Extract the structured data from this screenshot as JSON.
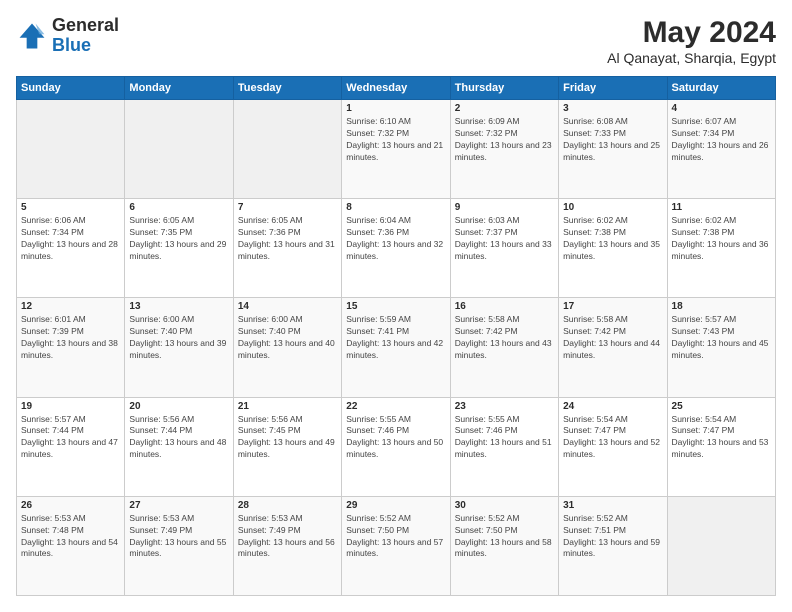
{
  "logo": {
    "line1": "General",
    "line2": "Blue"
  },
  "title": "May 2024",
  "subtitle": "Al Qanayat, Sharqia, Egypt",
  "weekdays": [
    "Sunday",
    "Monday",
    "Tuesday",
    "Wednesday",
    "Thursday",
    "Friday",
    "Saturday"
  ],
  "weeks": [
    [
      {
        "day": "",
        "sunrise": "",
        "sunset": "",
        "daylight": ""
      },
      {
        "day": "",
        "sunrise": "",
        "sunset": "",
        "daylight": ""
      },
      {
        "day": "",
        "sunrise": "",
        "sunset": "",
        "daylight": ""
      },
      {
        "day": "1",
        "sunrise": "Sunrise: 6:10 AM",
        "sunset": "Sunset: 7:32 PM",
        "daylight": "Daylight: 13 hours and 21 minutes."
      },
      {
        "day": "2",
        "sunrise": "Sunrise: 6:09 AM",
        "sunset": "Sunset: 7:32 PM",
        "daylight": "Daylight: 13 hours and 23 minutes."
      },
      {
        "day": "3",
        "sunrise": "Sunrise: 6:08 AM",
        "sunset": "Sunset: 7:33 PM",
        "daylight": "Daylight: 13 hours and 25 minutes."
      },
      {
        "day": "4",
        "sunrise": "Sunrise: 6:07 AM",
        "sunset": "Sunset: 7:34 PM",
        "daylight": "Daylight: 13 hours and 26 minutes."
      }
    ],
    [
      {
        "day": "5",
        "sunrise": "Sunrise: 6:06 AM",
        "sunset": "Sunset: 7:34 PM",
        "daylight": "Daylight: 13 hours and 28 minutes."
      },
      {
        "day": "6",
        "sunrise": "Sunrise: 6:05 AM",
        "sunset": "Sunset: 7:35 PM",
        "daylight": "Daylight: 13 hours and 29 minutes."
      },
      {
        "day": "7",
        "sunrise": "Sunrise: 6:05 AM",
        "sunset": "Sunset: 7:36 PM",
        "daylight": "Daylight: 13 hours and 31 minutes."
      },
      {
        "day": "8",
        "sunrise": "Sunrise: 6:04 AM",
        "sunset": "Sunset: 7:36 PM",
        "daylight": "Daylight: 13 hours and 32 minutes."
      },
      {
        "day": "9",
        "sunrise": "Sunrise: 6:03 AM",
        "sunset": "Sunset: 7:37 PM",
        "daylight": "Daylight: 13 hours and 33 minutes."
      },
      {
        "day": "10",
        "sunrise": "Sunrise: 6:02 AM",
        "sunset": "Sunset: 7:38 PM",
        "daylight": "Daylight: 13 hours and 35 minutes."
      },
      {
        "day": "11",
        "sunrise": "Sunrise: 6:02 AM",
        "sunset": "Sunset: 7:38 PM",
        "daylight": "Daylight: 13 hours and 36 minutes."
      }
    ],
    [
      {
        "day": "12",
        "sunrise": "Sunrise: 6:01 AM",
        "sunset": "Sunset: 7:39 PM",
        "daylight": "Daylight: 13 hours and 38 minutes."
      },
      {
        "day": "13",
        "sunrise": "Sunrise: 6:00 AM",
        "sunset": "Sunset: 7:40 PM",
        "daylight": "Daylight: 13 hours and 39 minutes."
      },
      {
        "day": "14",
        "sunrise": "Sunrise: 6:00 AM",
        "sunset": "Sunset: 7:40 PM",
        "daylight": "Daylight: 13 hours and 40 minutes."
      },
      {
        "day": "15",
        "sunrise": "Sunrise: 5:59 AM",
        "sunset": "Sunset: 7:41 PM",
        "daylight": "Daylight: 13 hours and 42 minutes."
      },
      {
        "day": "16",
        "sunrise": "Sunrise: 5:58 AM",
        "sunset": "Sunset: 7:42 PM",
        "daylight": "Daylight: 13 hours and 43 minutes."
      },
      {
        "day": "17",
        "sunrise": "Sunrise: 5:58 AM",
        "sunset": "Sunset: 7:42 PM",
        "daylight": "Daylight: 13 hours and 44 minutes."
      },
      {
        "day": "18",
        "sunrise": "Sunrise: 5:57 AM",
        "sunset": "Sunset: 7:43 PM",
        "daylight": "Daylight: 13 hours and 45 minutes."
      }
    ],
    [
      {
        "day": "19",
        "sunrise": "Sunrise: 5:57 AM",
        "sunset": "Sunset: 7:44 PM",
        "daylight": "Daylight: 13 hours and 47 minutes."
      },
      {
        "day": "20",
        "sunrise": "Sunrise: 5:56 AM",
        "sunset": "Sunset: 7:44 PM",
        "daylight": "Daylight: 13 hours and 48 minutes."
      },
      {
        "day": "21",
        "sunrise": "Sunrise: 5:56 AM",
        "sunset": "Sunset: 7:45 PM",
        "daylight": "Daylight: 13 hours and 49 minutes."
      },
      {
        "day": "22",
        "sunrise": "Sunrise: 5:55 AM",
        "sunset": "Sunset: 7:46 PM",
        "daylight": "Daylight: 13 hours and 50 minutes."
      },
      {
        "day": "23",
        "sunrise": "Sunrise: 5:55 AM",
        "sunset": "Sunset: 7:46 PM",
        "daylight": "Daylight: 13 hours and 51 minutes."
      },
      {
        "day": "24",
        "sunrise": "Sunrise: 5:54 AM",
        "sunset": "Sunset: 7:47 PM",
        "daylight": "Daylight: 13 hours and 52 minutes."
      },
      {
        "day": "25",
        "sunrise": "Sunrise: 5:54 AM",
        "sunset": "Sunset: 7:47 PM",
        "daylight": "Daylight: 13 hours and 53 minutes."
      }
    ],
    [
      {
        "day": "26",
        "sunrise": "Sunrise: 5:53 AM",
        "sunset": "Sunset: 7:48 PM",
        "daylight": "Daylight: 13 hours and 54 minutes."
      },
      {
        "day": "27",
        "sunrise": "Sunrise: 5:53 AM",
        "sunset": "Sunset: 7:49 PM",
        "daylight": "Daylight: 13 hours and 55 minutes."
      },
      {
        "day": "28",
        "sunrise": "Sunrise: 5:53 AM",
        "sunset": "Sunset: 7:49 PM",
        "daylight": "Daylight: 13 hours and 56 minutes."
      },
      {
        "day": "29",
        "sunrise": "Sunrise: 5:52 AM",
        "sunset": "Sunset: 7:50 PM",
        "daylight": "Daylight: 13 hours and 57 minutes."
      },
      {
        "day": "30",
        "sunrise": "Sunrise: 5:52 AM",
        "sunset": "Sunset: 7:50 PM",
        "daylight": "Daylight: 13 hours and 58 minutes."
      },
      {
        "day": "31",
        "sunrise": "Sunrise: 5:52 AM",
        "sunset": "Sunset: 7:51 PM",
        "daylight": "Daylight: 13 hours and 59 minutes."
      },
      {
        "day": "",
        "sunrise": "",
        "sunset": "",
        "daylight": ""
      }
    ]
  ]
}
